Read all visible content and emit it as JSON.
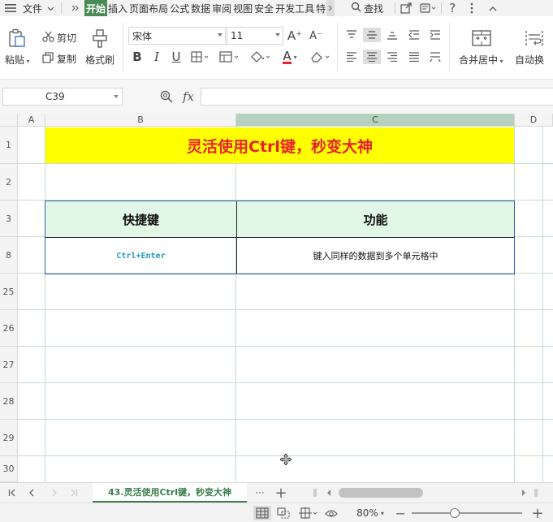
{
  "menubar": {
    "file_label": "文件",
    "tabs": [
      "开始",
      "插入",
      "页面布局",
      "公式",
      "数据",
      "审阅",
      "视图",
      "安全",
      "开发工具",
      "特"
    ],
    "active_tab": "开始",
    "search_label": "查找"
  },
  "ribbon": {
    "paste_label": "粘贴",
    "cut_label": "剪切",
    "copy_label": "复制",
    "format_painter_label": "格式刷",
    "font_name": "宋体",
    "font_size": "11",
    "merge_label": "合并居中",
    "wrap_label": "自动换",
    "bold_glyph": "B",
    "italic_glyph": "I",
    "underline_glyph": "U",
    "font_color_glyph": "A",
    "grow_font_glyph": "A⁺",
    "shrink_font_glyph": "A⁻"
  },
  "formula": {
    "cell_ref": "C39",
    "fx_label": "fx",
    "value": ""
  },
  "grid": {
    "columns": [
      "A",
      "B",
      "C",
      "D"
    ],
    "selected_column": "C",
    "rows": [
      "1",
      "2",
      "3",
      "8",
      "25",
      "26",
      "27",
      "28",
      "29",
      "30"
    ],
    "title": "灵活使用Ctrl键，秒变大神",
    "table": {
      "headers": [
        "快捷键",
        "功能"
      ],
      "rows": [
        [
          "Ctrl+Enter",
          "键入同样的数据到多个单元格中"
        ]
      ]
    },
    "colors": {
      "title_bg": "#ffff00",
      "title_text": "#e8232a",
      "header_bg": "#e2f8e6",
      "shortcut_text": "#1e9bbd"
    }
  },
  "sheet": {
    "tab_name": "43.灵活使用Ctrl键，秒变大神",
    "more_glyph": "···",
    "add_glyph": "+"
  },
  "status": {
    "zoom_label": "80%",
    "minus_glyph": "—",
    "plus_glyph": "+"
  }
}
